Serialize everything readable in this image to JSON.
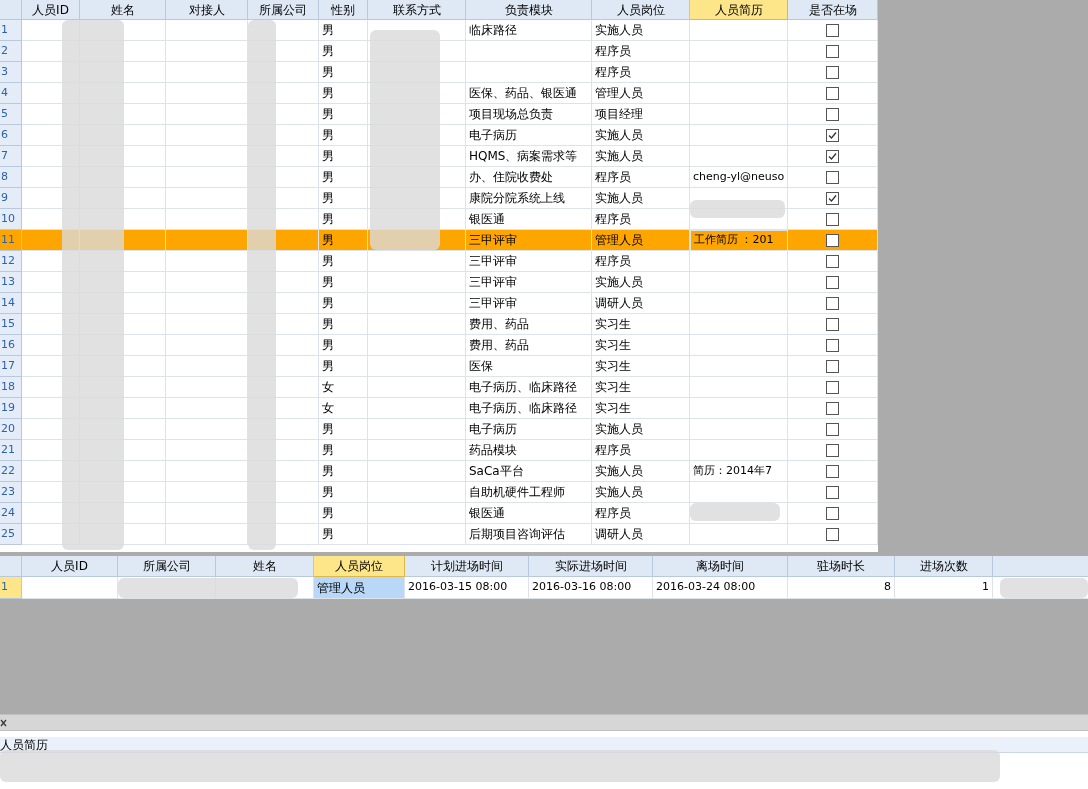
{
  "top_grid": {
    "columns": [
      {
        "label": "人员ID",
        "selected": false
      },
      {
        "label": "姓名",
        "selected": false
      },
      {
        "label": "对接人",
        "selected": false
      },
      {
        "label": "所属公司",
        "selected": false
      },
      {
        "label": "性别",
        "selected": false
      },
      {
        "label": "联系方式",
        "selected": false
      },
      {
        "label": "负责模块",
        "selected": false
      },
      {
        "label": "人员岗位",
        "selected": false
      },
      {
        "label": "人员简历",
        "selected": true
      },
      {
        "label": "是否在场",
        "selected": false
      }
    ],
    "rows": [
      {
        "number": "1",
        "selected": false,
        "gender": "男",
        "module": "临床路径",
        "position": "实施人员",
        "resume": "",
        "present": false
      },
      {
        "number": "2",
        "selected": false,
        "gender": "男",
        "module": "",
        "position": "程序员",
        "resume": "",
        "present": false
      },
      {
        "number": "3",
        "selected": false,
        "gender": "男",
        "module": "",
        "position": "程序员",
        "resume": "",
        "present": false
      },
      {
        "number": "4",
        "selected": false,
        "gender": "男",
        "module": "医保、药品、银医通",
        "position": "管理人员",
        "resume": "",
        "present": false
      },
      {
        "number": "5",
        "selected": false,
        "gender": "男",
        "module": "项目现场总负责",
        "position": "项目经理",
        "resume": "",
        "present": false
      },
      {
        "number": "6",
        "selected": false,
        "gender": "男",
        "module": "电子病历",
        "position": "实施人员",
        "resume": "",
        "present": true
      },
      {
        "number": "7",
        "selected": false,
        "gender": "男",
        "module": "HQMS、病案需求等",
        "position": "实施人员",
        "resume": "",
        "present": true
      },
      {
        "number": "8",
        "selected": false,
        "gender": "男",
        "module": "办、住院收费处",
        "position": "程序员",
        "resume": "cheng-yl@neuso",
        "present": false
      },
      {
        "number": "9",
        "selected": false,
        "gender": "男",
        "module": "康院分院系统上线",
        "position": "实施人员",
        "resume": "",
        "present": true
      },
      {
        "number": "10",
        "selected": false,
        "gender": "男",
        "module": "银医通",
        "position": "程序员",
        "resume": "",
        "present": false
      },
      {
        "number": "11",
        "selected": true,
        "gender": "男",
        "module": "三甲评审",
        "position": "管理人员",
        "resume": "工作简历 ：201",
        "present": false
      },
      {
        "number": "12",
        "selected": false,
        "gender": "男",
        "module": "三甲评审",
        "position": "程序员",
        "resume": "",
        "present": false
      },
      {
        "number": "13",
        "selected": false,
        "gender": "男",
        "module": "三甲评审",
        "position": "实施人员",
        "resume": "",
        "present": false
      },
      {
        "number": "14",
        "selected": false,
        "gender": "男",
        "module": "三甲评审",
        "position": "调研人员",
        "resume": "",
        "present": false
      },
      {
        "number": "15",
        "selected": false,
        "gender": "男",
        "module": "费用、药品",
        "position": "实习生",
        "resume": "",
        "present": false
      },
      {
        "number": "16",
        "selected": false,
        "gender": "男",
        "module": "费用、药品",
        "position": "实习生",
        "resume": "",
        "present": false
      },
      {
        "number": "17",
        "selected": false,
        "gender": "男",
        "module": "医保",
        "position": "实习生",
        "resume": "",
        "present": false
      },
      {
        "number": "18",
        "selected": false,
        "gender": "女",
        "module": "电子病历、临床路径",
        "position": "实习生",
        "resume": "",
        "present": false
      },
      {
        "number": "19",
        "selected": false,
        "gender": "女",
        "module": "电子病历、临床路径",
        "position": "实习生",
        "resume": "",
        "present": false
      },
      {
        "number": "20",
        "selected": false,
        "gender": "男",
        "module": "电子病历",
        "position": "实施人员",
        "resume": "",
        "present": false
      },
      {
        "number": "21",
        "selected": false,
        "gender": "男",
        "module": "药品模块",
        "position": "程序员",
        "resume": "",
        "present": false
      },
      {
        "number": "22",
        "selected": false,
        "gender": "男",
        "module": "SaCa平台",
        "position": "实施人员",
        "resume": "简历：2014年7",
        "present": false
      },
      {
        "number": "23",
        "selected": false,
        "gender": "男",
        "module": "自助机硬件工程师",
        "position": "实施人员",
        "resume": "",
        "present": false
      },
      {
        "number": "24",
        "selected": false,
        "gender": "男",
        "module": "银医通",
        "position": "程序员",
        "resume": "",
        "present": false
      },
      {
        "number": "25",
        "selected": false,
        "gender": "男",
        "module": "后期项目咨询评估",
        "position": "调研人员",
        "resume": "",
        "present": false
      }
    ]
  },
  "bottom_grid": {
    "columns": [
      {
        "label": "人员ID",
        "selected": false,
        "kind": "text"
      },
      {
        "label": "所属公司",
        "selected": false,
        "kind": "text"
      },
      {
        "label": "姓名",
        "selected": false,
        "kind": "text"
      },
      {
        "label": "人员岗位",
        "selected": true,
        "kind": "text"
      },
      {
        "label": "计划进场时间",
        "selected": false,
        "kind": "text"
      },
      {
        "label": "实际进场时间",
        "selected": false,
        "kind": "text"
      },
      {
        "label": "离场时间",
        "selected": false,
        "kind": "text"
      },
      {
        "label": "驻场时长",
        "selected": false,
        "kind": "number"
      },
      {
        "label": "进场次数",
        "selected": false,
        "kind": "number"
      }
    ],
    "rows": [
      {
        "number": "1",
        "selected": true,
        "cells": [
          "",
          "",
          "",
          "管理人员",
          "2016-03-15 08:00",
          "2016-03-16 08:00",
          "2016-03-24 08:00",
          "8",
          "1"
        ]
      }
    ]
  },
  "detail_panel": {
    "label": "人员简历"
  }
}
